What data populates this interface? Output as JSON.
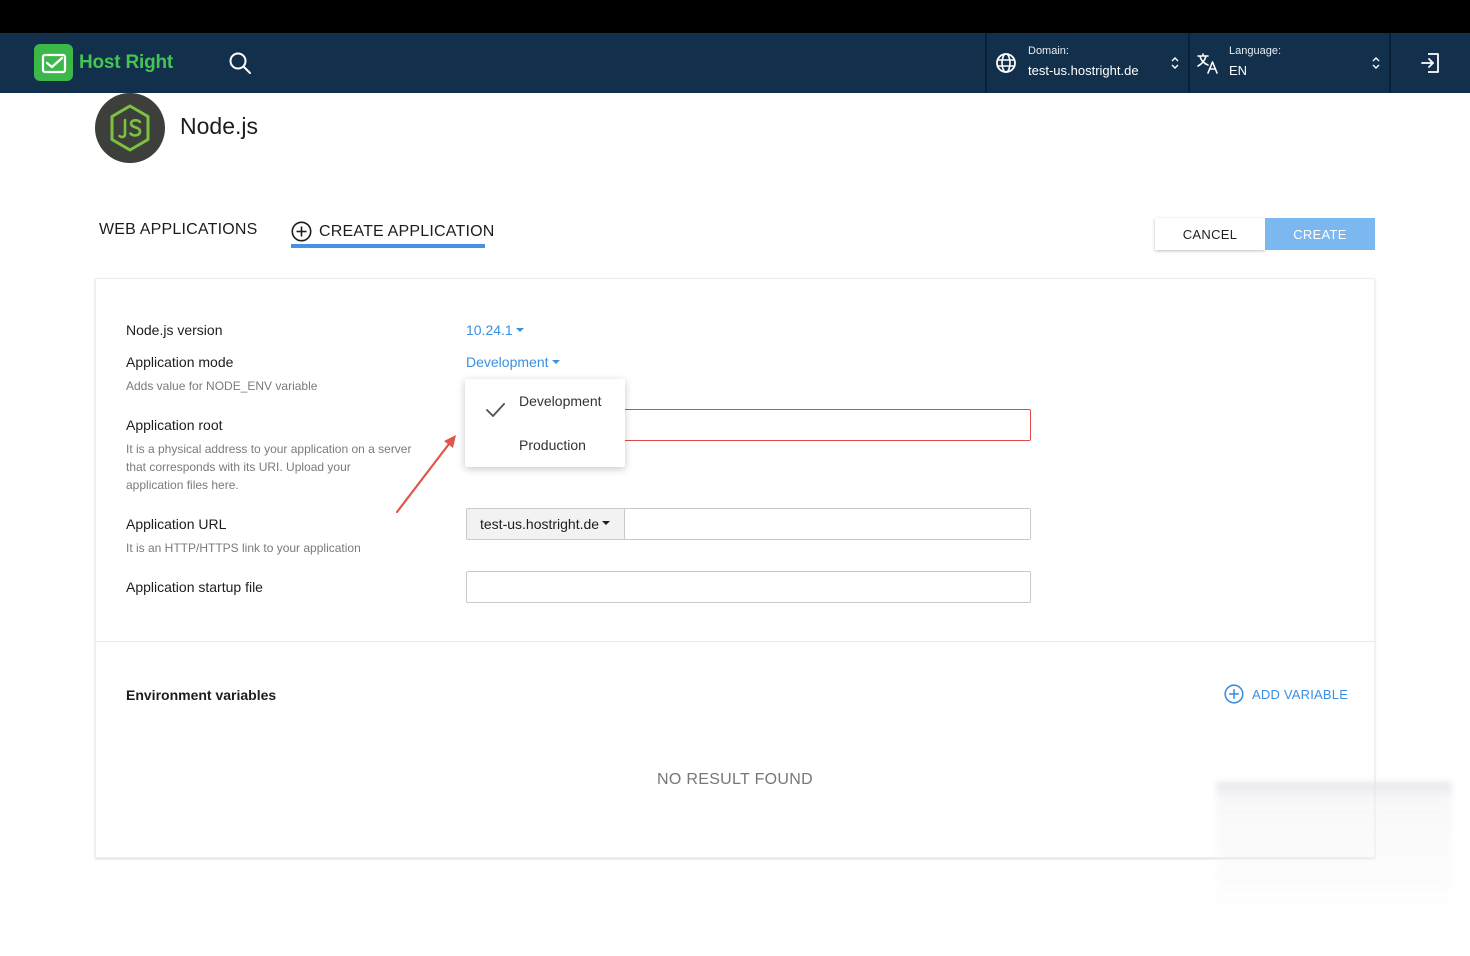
{
  "navbar": {
    "brand": "Host Right",
    "domain_label": "Domain:",
    "domain_value": "test-us.hostright.de",
    "language_label": "Language:",
    "language_value": "EN"
  },
  "page": {
    "title": "Node.js"
  },
  "tabs": {
    "web_applications": "WEB APPLICATIONS",
    "create_application": "CREATE APPLICATION"
  },
  "actions": {
    "cancel": "CANCEL",
    "create": "CREATE"
  },
  "form": {
    "version_label": "Node.js version",
    "version_value": "10.24.1",
    "mode_label": "Application mode",
    "mode_hint": "Adds value for NODE_ENV variable",
    "mode_value": "Development",
    "root_label": "Application root",
    "root_hint_1": "It is a physical address to your application on a server",
    "root_hint_2": "that corresponds with its URI. Upload your",
    "root_hint_3": "application files here.",
    "url_label": "Application URL",
    "url_hint": "It is an HTTP/HTTPS link to your application",
    "url_domain": "test-us.hostright.de",
    "startup_label": "Application startup file"
  },
  "mode_dropdown": {
    "options": [
      "Development",
      "Production"
    ],
    "selected": "Development"
  },
  "env": {
    "title": "Environment variables",
    "add_label": "ADD VARIABLE",
    "empty": "NO RESULT FOUND"
  },
  "colors": {
    "navbar": "#12304c",
    "brand_green": "#44c553",
    "accent": "#3d8fe0",
    "create_button": "#7ab8ef",
    "error": "#e04a4a"
  }
}
